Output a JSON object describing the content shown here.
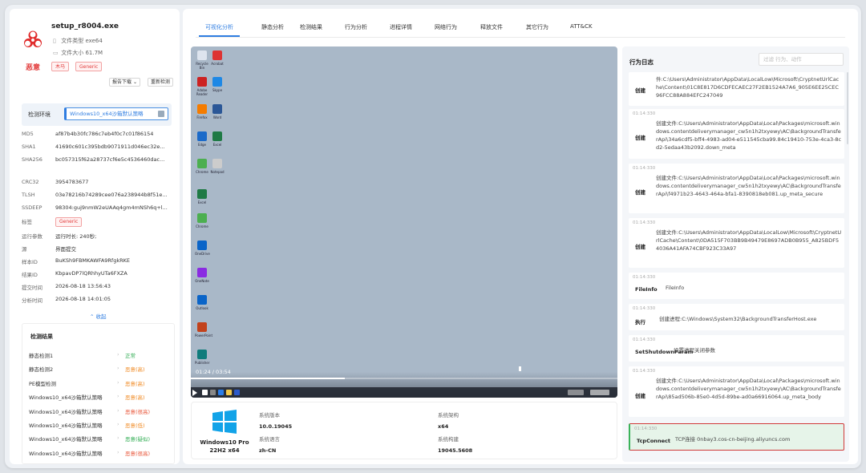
{
  "file": {
    "name": "setup_r8004.exe",
    "type_label": "文件类型",
    "type_value": "exe64",
    "size_label": "文件大小",
    "size_value": "61.7M",
    "verdict": "恶意",
    "tags": [
      "木马",
      "Generic"
    ],
    "report_download": "报告下载",
    "recheck": "重新检测"
  },
  "env": {
    "label": "检测环境",
    "value": "Windows10_x64沙箱默认策略"
  },
  "details": [
    {
      "key": "MD5",
      "value": "af87b4b30fc786c7eb4f0c7c01f86154"
    },
    {
      "key": "SHA1",
      "value": "41690c601c395bdb9071911d046ec32e..."
    },
    {
      "key": "SHA256",
      "value": "bc057315f62a28737cf6e5c4536460dac..."
    },
    {
      "key": "CRC32",
      "value": "3954783677"
    },
    {
      "key": "TLSH",
      "value": "03e78216b74289cee076a238944b8f51e..."
    },
    {
      "key": "SSDEEP",
      "value": "98304:guj9nmW2eUAAq4gm4mNSh6q+l..."
    },
    {
      "key": "标签",
      "value": "Generic"
    },
    {
      "key": "运行参数",
      "value": "运行时长: 240秒;"
    },
    {
      "key": "源",
      "value": "界面提交"
    },
    {
      "key": "样本ID",
      "value": "BuKSh9FBMKAWFA9RfgkRKE"
    },
    {
      "key": "结果ID",
      "value": "KbpavDP7lQRhhyUTa6FXZA"
    },
    {
      "key": "提交时间",
      "value": "2026-08-18 13:56:43"
    },
    {
      "key": "分析时间",
      "value": "2026-08-18 14:01:05"
    }
  ],
  "collapse_label": "收起",
  "results": {
    "title": "检测结果",
    "rows": [
      {
        "name": "静态检测1",
        "status": "正常",
        "color": "#2dab50"
      },
      {
        "name": "静态检测2",
        "status": "恶意(高)",
        "color": "#f08a24"
      },
      {
        "name": "PE模型检测",
        "status": "恶意(高)",
        "color": "#f08a24"
      },
      {
        "name": "Windows10_x64沙箱默认策略",
        "status": "恶意(高)",
        "color": "#f08a24"
      },
      {
        "name": "Windows10_x64沙箱默认策略",
        "status": "恶意(很高)",
        "color": "#e8563a"
      },
      {
        "name": "Windows10_x64沙箱默认策略",
        "status": "恶意(低)",
        "color": "#f08a24"
      },
      {
        "name": "Windows10_x64沙箱默认策略",
        "status": "恶意(疑似)",
        "color": "#2dab50"
      },
      {
        "name": "Windows10_x64沙箱默认策略",
        "status": "恶意(很高)",
        "color": "#e8563a"
      },
      {
        "name": "Windows10_x64沙箱默认策略",
        "status": "恶意(高)",
        "color": "#f08a24"
      }
    ]
  },
  "tabs": [
    "可视化分析",
    "静态分析",
    "检测结果",
    "行为分析",
    "进程详情",
    "网络行为",
    "释放文件",
    "其它行为",
    "ATT&CK"
  ],
  "video": {
    "time": "01:24 / 03:54",
    "progress": 0.36
  },
  "desktop_icons": [
    "Recycle Bin",
    "Acrobat",
    "Adobe Reader",
    "Skype",
    "Firefox",
    "Word",
    "Edge",
    "Excel",
    "Chrome",
    "Notepad",
    "Excel",
    "Chrome",
    "OneDrive",
    "OneNote",
    "Outlook",
    "PowerPoint",
    "Publisher"
  ],
  "sysinfo": {
    "os_name": "Windows10 Pro",
    "os_sub": "22H2 x64",
    "items": [
      {
        "label": "系统版本",
        "value": "10.0.19045"
      },
      {
        "label": "系统架构",
        "value": "x64"
      },
      {
        "label": "系统语言",
        "value": "zh-CN"
      },
      {
        "label": "系统构建",
        "value": "19045.5608"
      }
    ]
  },
  "log": {
    "title": "行为日志",
    "search_placeholder": "过滤 行为、动作",
    "entries": [
      {
        "time": "",
        "action": "创建",
        "detail": "件:C:\\Users\\Administrator\\AppData\\LocalLow\\Microsoft\\CryptnetUrlCache\\Content\\01C8E817D6CDFECAEC27F2EB1524A7A6_905E6EE25CEC96FCC88A884EFC247049"
      },
      {
        "time": "01:14:330",
        "action": "创建",
        "detail": "创建文件:C:\\Users\\Administrator\\AppData\\Local\\Packages\\microsoft.windows.contentdeliverymanager_cw5n1h2txyewy\\AC\\BackgroundTransferApi\\34a6cdf5-bff4-4983-ad04-e511545cba99.84c19410-753e-4ca3-8cd2-5edaa43b2092.down_meta"
      },
      {
        "time": "01:14:330",
        "action": "创建",
        "detail": "创建文件:C:\\Users\\Administrator\\AppData\\Local\\Packages\\microsoft.windows.contentdeliverymanager_cw5n1h2txyewy\\AC\\BackgroundTransferApi\\f4971b23-4643-464a-bfa1-8390818eb081.up_meta_secure"
      },
      {
        "time": "01:14:330",
        "action": "创建",
        "detail": "创建文件:C:\\Users\\Administrator\\AppData\\LocalLow\\Microsoft\\CryptnetUrlCache\\Content\\0DA515F703BB9B49479E8697ADB0B955_A825BDF54036A41AFA74CBF923C33A97"
      },
      {
        "time": "01:14:330",
        "action": "FileInfo",
        "detail": "FileInfo"
      },
      {
        "time": "01:14:330",
        "action": "执行",
        "detail": "创建进程:C:\\Windows\\System32\\BackgroundTransferHost.exe"
      },
      {
        "time": "01:14:330",
        "action": "SetShutdownParam",
        "detail": "设置进程关闭参数"
      },
      {
        "time": "01:14:330",
        "action": "创建",
        "detail": "创建文件:C:\\Users\\Administrator\\AppData\\Local\\Packages\\microsoft.windows.contentdeliverymanager_cw5n1h2txyewy\\AC\\BackgroundTransferApi\\85ad506b-85e0-4d5d-89be-ad0a66916064.up_meta_body"
      },
      {
        "time": "01:14:330",
        "action": "TcpConnect",
        "detail": "TCP连接 0nbay3.cos-cn-beijing.aliyuncs.com"
      }
    ]
  }
}
